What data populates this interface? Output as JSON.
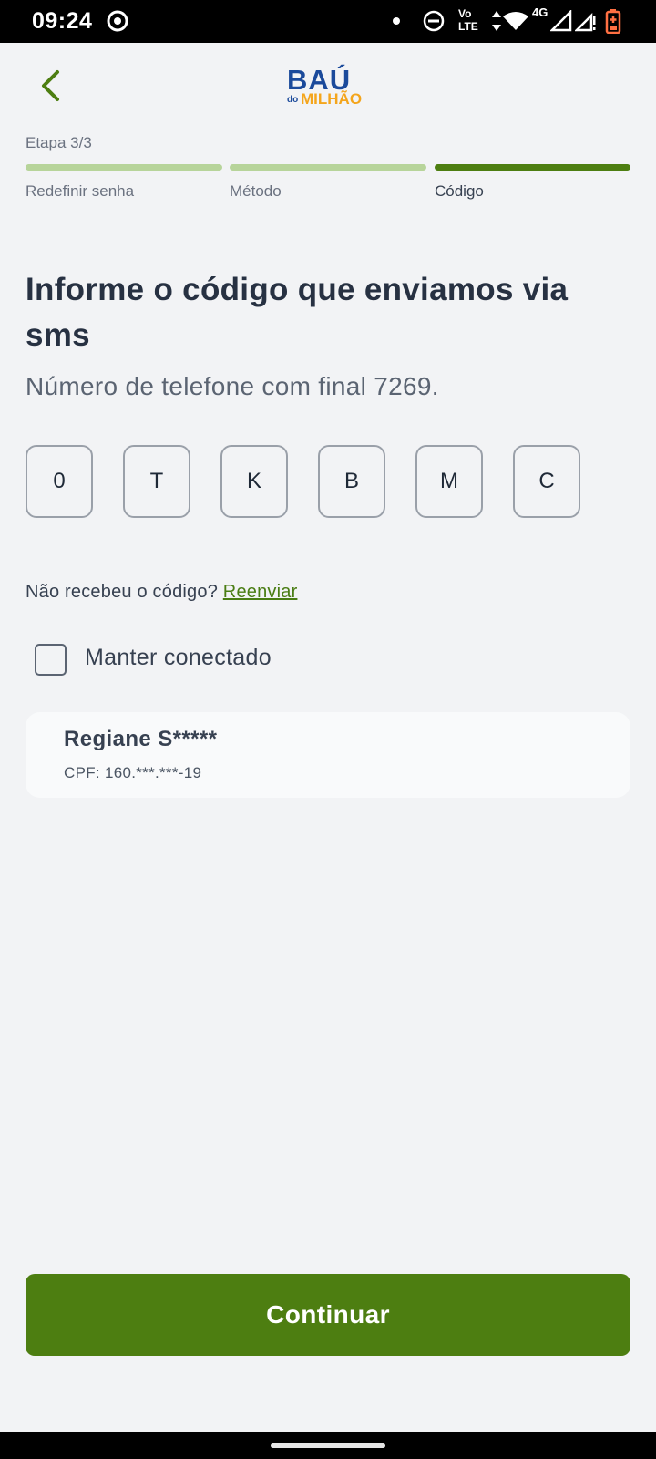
{
  "status_bar": {
    "time": "09:24",
    "network_label_top": "Vo",
    "network_label_bottom": "LTE",
    "network_type": "4G",
    "icons": [
      "record-icon",
      "dot-icon",
      "do-not-disturb-icon",
      "volte-icon",
      "data-arrows-icon",
      "wifi-icon",
      "signal-icon",
      "signal-icon",
      "battery-charging-icon"
    ]
  },
  "header": {
    "back_icon": "chevron-left-icon",
    "logo_top": "BAÚ",
    "logo_small": "do",
    "logo_bottom": "MILHÃO",
    "colors": {
      "logo_blue": "#1b4a9b",
      "logo_orange": "#f4a51c"
    }
  },
  "progress": {
    "step_label": "Etapa 3/3",
    "steps": [
      {
        "label": "Redefinir senha",
        "state": "done"
      },
      {
        "label": "Método",
        "state": "done"
      },
      {
        "label": "Código",
        "state": "current"
      }
    ],
    "colors": {
      "done": "#b7d49a",
      "current": "#4d7e11"
    }
  },
  "main": {
    "title": "Informe o código que enviamos via sms",
    "subtitle": "Número de telefone com final 7269.",
    "code_digits": [
      "0",
      "T",
      "K",
      "B",
      "M",
      "C"
    ],
    "resend_prompt": "Não recebeu o código?",
    "resend_link": "Reenviar",
    "keep_connected_label": "Manter conectado",
    "keep_connected_checked": false
  },
  "user_card": {
    "name": "Regiane S*****",
    "cpf": "CPF: 160.***.***-19"
  },
  "actions": {
    "continue_label": "Continuar",
    "accent_color": "#4d7e11"
  }
}
